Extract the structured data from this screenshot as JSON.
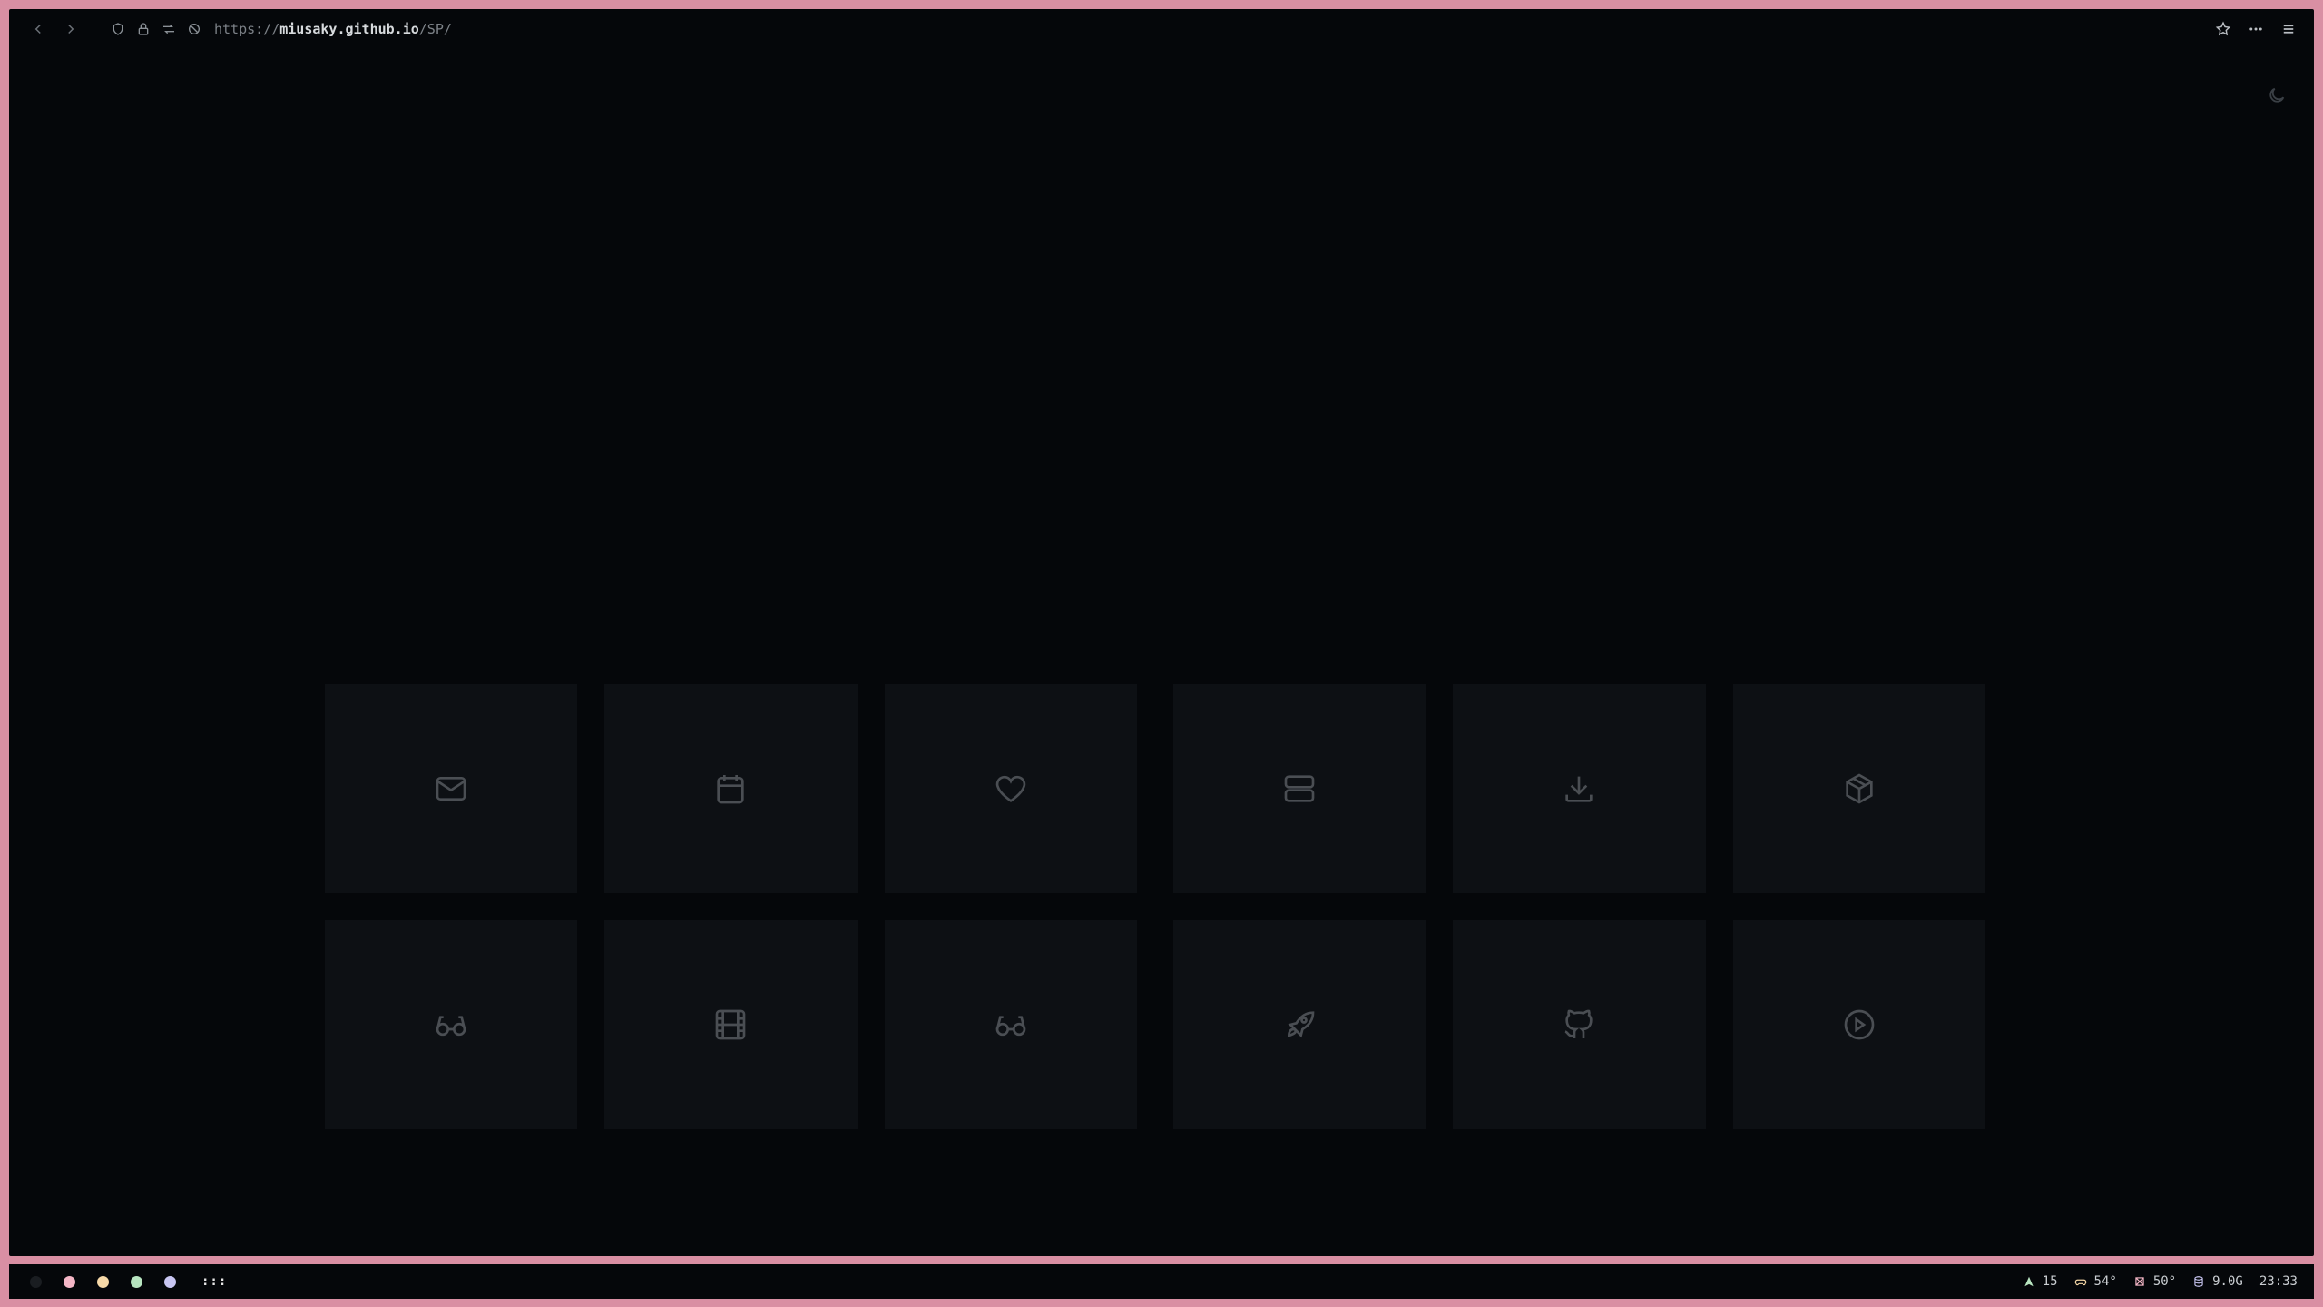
{
  "browser": {
    "url": {
      "scheme": "https://",
      "host": "miusaky.github.io",
      "path": "/SP/"
    },
    "nav": [
      "back-icon",
      "forward-icon"
    ],
    "security_icons": [
      "shield-icon",
      "lock-icon",
      "permissions-icon",
      "tracking-icon"
    ],
    "toolbar_right": [
      "star-icon",
      "more-icon",
      "menu-icon"
    ]
  },
  "page": {
    "theme_toggle_icon": "moon-icon",
    "tiles": [
      [
        {
          "icon": "mail-icon"
        },
        {
          "icon": "calendar-icon"
        },
        {
          "icon": "heart-icon"
        },
        {
          "icon": "server-icon"
        },
        {
          "icon": "download-icon"
        },
        {
          "icon": "package-icon"
        }
      ],
      [
        {
          "icon": "glasses-icon"
        },
        {
          "icon": "film-icon"
        },
        {
          "icon": "glasses-icon"
        },
        {
          "icon": "rocket-icon"
        },
        {
          "icon": "github-icon"
        },
        {
          "icon": "play-circle-icon"
        }
      ]
    ]
  },
  "statusbar": {
    "workspace_dots": [
      "#1a1d21",
      "#f4b6c6",
      "#f7d9a8",
      "#b7e4c0",
      "#c8c6f2"
    ],
    "workspace_label": ":::",
    "stats": {
      "updates": "15",
      "cpu_temp": "54°",
      "gpu_temp": "50°",
      "memory": "9.0G",
      "clock": "23:33"
    }
  }
}
